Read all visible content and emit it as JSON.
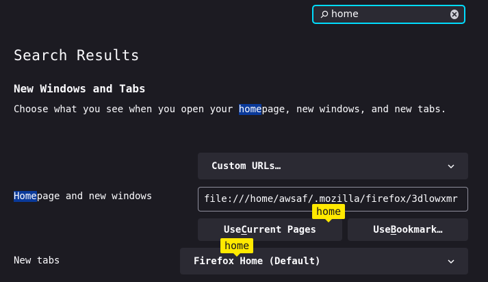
{
  "search": {
    "value": "home",
    "placeholder": ""
  },
  "page_title": "Search Results",
  "section": {
    "heading": "New Windows and Tabs",
    "desc_highlight": "home",
    "desc_after": "page, new windows, and new tabs.",
    "desc_before": "Choose what you see when you open your "
  },
  "homepage": {
    "label_highlight": "Home",
    "label_rest": "page and new windows",
    "dropdown_value": "Custom URLs…",
    "url_value": "file:///home/awsaf/.mozilla/firefox/3dlowxmr",
    "use_current_prefix": "Use ",
    "use_current_access": "C",
    "use_current_suffix": "urrent Pages",
    "use_bookmark_prefix": "Use ",
    "use_bookmark_access": "B",
    "use_bookmark_suffix": "ookmark…"
  },
  "newtabs": {
    "label": "New tabs",
    "dropdown_value": "Firefox Home (Default)"
  },
  "badges": {
    "current_pages": "home",
    "new_tabs": "home"
  },
  "colors": {
    "background": "#1c1b22",
    "accent": "#00ddff",
    "highlight": "#0a3a9a",
    "badge": "#ffe900"
  }
}
